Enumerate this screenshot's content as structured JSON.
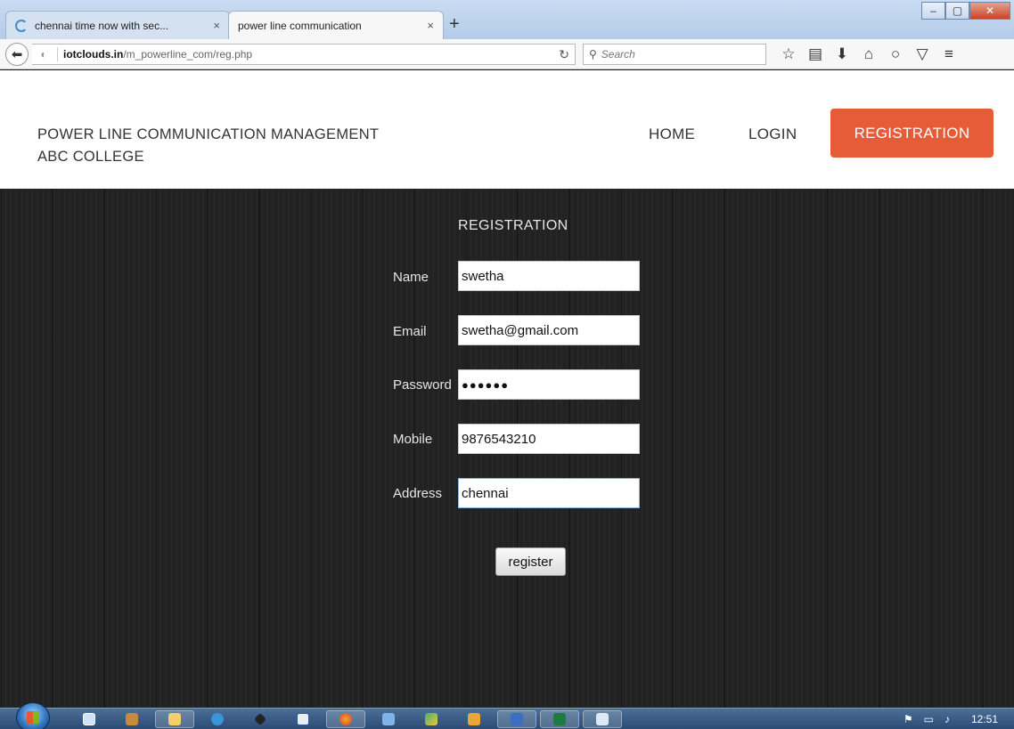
{
  "browser": {
    "tabs": [
      {
        "title": "chennai time now with sec...",
        "active": false,
        "loading": true
      },
      {
        "title": "power line communication",
        "active": true,
        "loading": false
      }
    ],
    "new_tab_icon": "plus-icon",
    "url_domain": "iotclouds.in",
    "url_path": "/m_powerline_com/reg.php",
    "search_placeholder": "Search",
    "window_controls": [
      "minimize-icon",
      "maximize-icon",
      "close-icon"
    ],
    "toolbar_icons": [
      "bookmark-star-icon",
      "reading-list-icon",
      "download-icon",
      "home-icon",
      "chat-icon",
      "pocket-icon",
      "menu-icon"
    ]
  },
  "site": {
    "brand_line1": "POWER LINE COMMUNICATION MANAGEMENT",
    "brand_line2": "ABC COLLEGE",
    "nav": {
      "home": "HOME",
      "login": "LOGIN",
      "registration": "REGISTRATION"
    },
    "accent_color": "#e65c38"
  },
  "form": {
    "title": "REGISTRATION",
    "fields": [
      {
        "label": "Name",
        "value": "swetha"
      },
      {
        "label": "Email",
        "value": "swetha@gmail.com"
      },
      {
        "label": "Password",
        "value": "●●●●●●"
      },
      {
        "label": "Mobile",
        "value": "9876543210"
      },
      {
        "label": "Address",
        "value": "chennai"
      }
    ],
    "submit_label": "register"
  },
  "taskbar": {
    "start_icon": "windows-start-icon",
    "apps": [
      "explorer-icon",
      "toolbox-icon",
      "folder-icon",
      "ie-icon",
      "pen-icon",
      "word-icon",
      "firefox-icon",
      "network-icon",
      "paint-icon",
      "package-icon",
      "visio-icon",
      "excel-icon",
      "notepad-icon"
    ],
    "clock": "12:51"
  }
}
